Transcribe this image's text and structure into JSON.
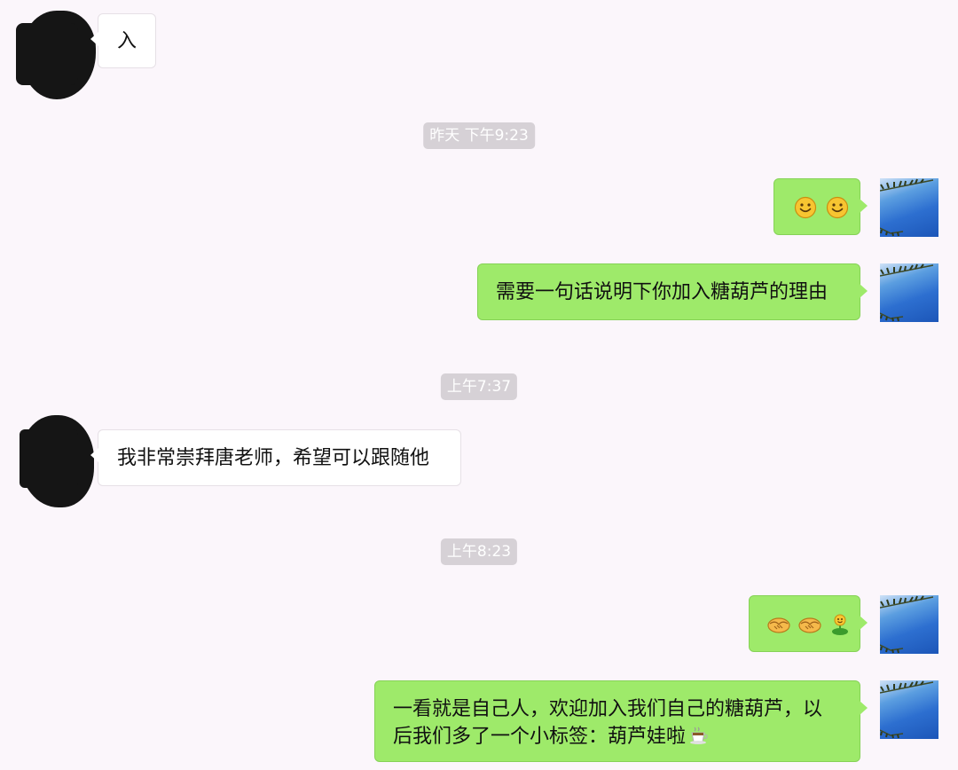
{
  "messages": [
    {
      "type": "incoming",
      "text": "入"
    },
    {
      "type": "timestamp",
      "text": "昨天 下午9:23"
    },
    {
      "type": "outgoing",
      "emojis": [
        "smile-emoji",
        "smile-emoji"
      ]
    },
    {
      "type": "outgoing",
      "text": "需要一句话说明下你加入糖葫芦的理由"
    },
    {
      "type": "timestamp",
      "text": "上午7:37"
    },
    {
      "type": "incoming",
      "text": "我非常崇拜唐老师，希望可以跟随他"
    },
    {
      "type": "timestamp",
      "text": "上午8:23"
    },
    {
      "type": "outgoing",
      "emojis": [
        "handshake-emoji",
        "handshake-emoji",
        "sprout-emoji"
      ]
    },
    {
      "type": "outgoing",
      "lines": [
        "一看就是自己人，欢迎加入我们自己的糖葫芦，以",
        "后我们多了一个小标签：葫芦娃啦"
      ],
      "trailing_emoji": "coffee-emoji"
    }
  ],
  "colors": {
    "background": "#fbf6fb",
    "outgoing_bubble": "#9eea6a",
    "incoming_bubble": "#ffffff",
    "timestamp_pill": "#d6d1d6"
  }
}
